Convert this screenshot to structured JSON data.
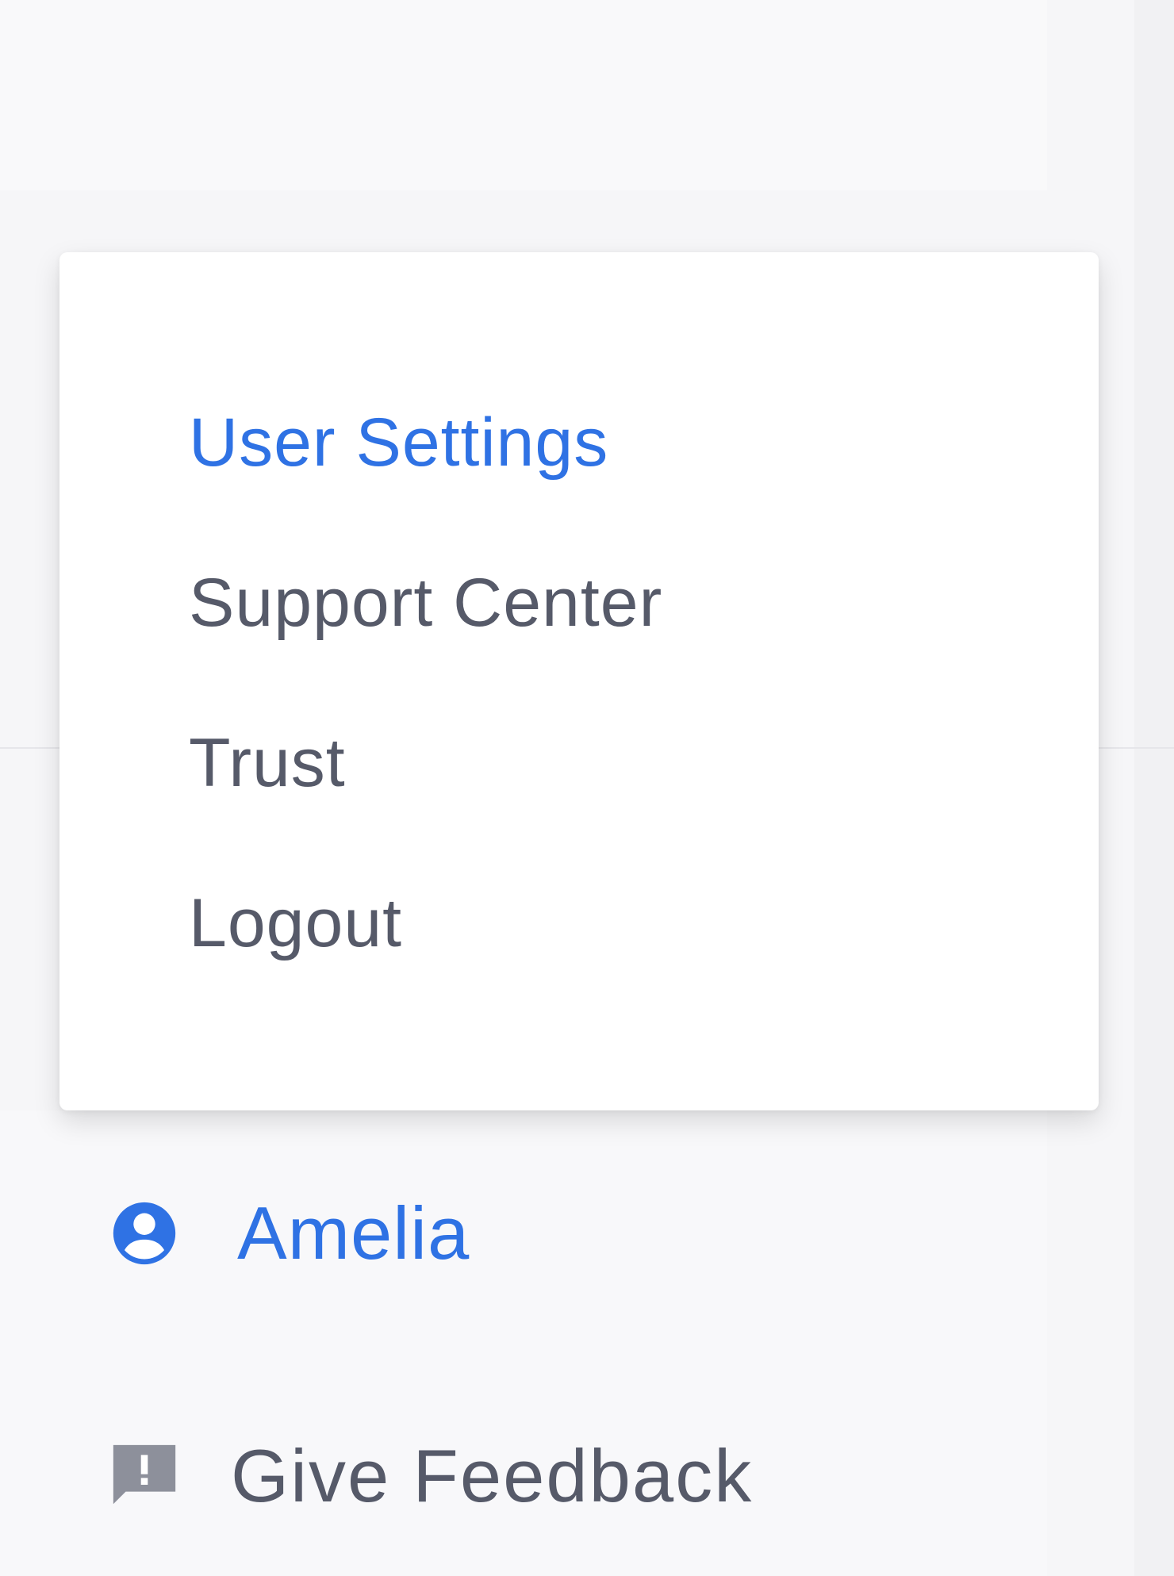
{
  "menu": {
    "items": [
      {
        "label": "User Settings",
        "active": true
      },
      {
        "label": "Support Center",
        "active": false
      },
      {
        "label": "Trust",
        "active": false
      },
      {
        "label": "Logout",
        "active": false
      }
    ]
  },
  "sidebar": {
    "account": {
      "name": "Amelia",
      "icon": "account-circle-icon"
    },
    "feedback": {
      "label": "Give Feedback",
      "icon": "feedback-icon"
    }
  },
  "colors": {
    "accent": "#2f72e4",
    "text": "#565a69",
    "icon_muted": "#8d909b",
    "background": "#f6f6f8",
    "menu_background": "#ffffff"
  }
}
